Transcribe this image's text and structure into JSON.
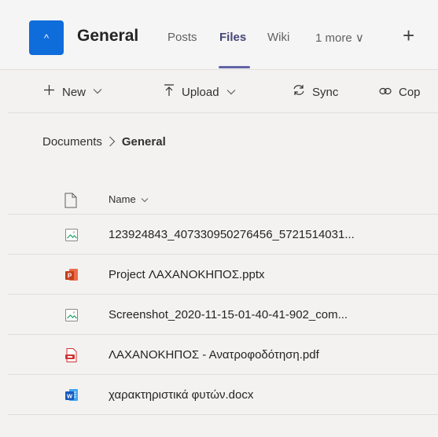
{
  "header": {
    "team_initial": "^",
    "channel_name": "General",
    "tabs": [
      {
        "label": "Posts"
      },
      {
        "label": "Files"
      },
      {
        "label": "Wiki"
      },
      {
        "label": "1 more ∨"
      }
    ],
    "add_tab": "+"
  },
  "commands": {
    "new": "New",
    "upload": "Upload",
    "sync": "Sync",
    "copy": "Cop"
  },
  "breadcrumb": {
    "root": "Documents",
    "current": "General"
  },
  "list": {
    "name_header": "Name",
    "files": [
      {
        "name": "123924843_407330950276456_5721514031...",
        "icon": "image-file-icon"
      },
      {
        "name": "Project ΛΑΧΑΝΟΚΗΠΟΣ.pptx",
        "icon": "powerpoint-file-icon"
      },
      {
        "name": "Screenshot_2020-11-15-01-40-41-902_com...",
        "icon": "image-file-icon"
      },
      {
        "name": "ΛΑΧΑΝΟΚΗΠΟΣ - Ανατροφοδότηση.pdf",
        "icon": "pdf-file-icon"
      },
      {
        "name": "χαρακτηριστικά φυτών.docx",
        "icon": "word-file-icon"
      }
    ]
  },
  "colors": {
    "accent": "#6264a7",
    "team_badge": "#0f6cdb",
    "powerpoint": "#c43e1c",
    "pdf": "#d13438",
    "word": "#185abd"
  }
}
